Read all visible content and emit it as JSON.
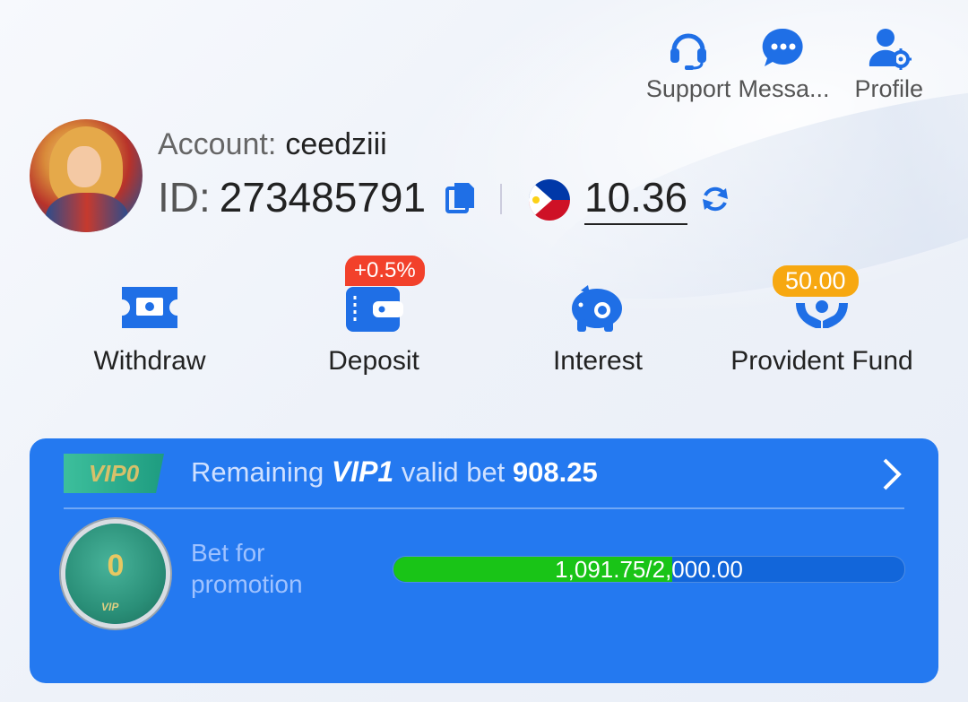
{
  "topnav": [
    {
      "label": "Support",
      "icon": "headset-icon"
    },
    {
      "label": "Messa...",
      "icon": "chat-bubble-icon"
    },
    {
      "label": "Profile",
      "icon": "user-settings-icon"
    }
  ],
  "account": {
    "label": "Account:",
    "username": "ceedziii",
    "id_label": "ID:",
    "id": "273485791",
    "balance": "10.36",
    "currency_flag": "philippines-flag-icon"
  },
  "actions": [
    {
      "label": "Withdraw",
      "icon": "ticket-money-icon"
    },
    {
      "label": "Deposit",
      "icon": "wallet-icon",
      "badge": "+0.5%"
    },
    {
      "label": "Interest",
      "icon": "piggy-bank-icon"
    },
    {
      "label": "Provident Fund",
      "icon": "hands-coins-icon",
      "badge": "50.00"
    }
  ],
  "vip": {
    "current_level": "VIP0",
    "remaining_prefix": "Remaining",
    "next_level": "VIP1",
    "valid_bet_label": "valid bet",
    "remaining_amount": "908.25",
    "medal_number": "0",
    "medal_tag": "VIP",
    "bet_label": "Bet for promotion",
    "progress_text": "1,091.75/2,000.00",
    "progress_fraction": 0.546
  },
  "colors": {
    "accent_blue": "#1f6fe6",
    "card_blue": "#2479f0",
    "badge_red": "#f2412b",
    "badge_yellow": "#f7a811",
    "progress_green": "#19c417"
  }
}
